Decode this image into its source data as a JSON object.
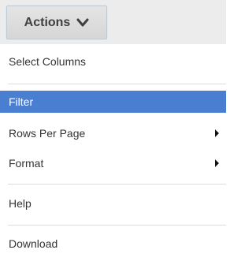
{
  "toolbar": {
    "actions_label": "Actions"
  },
  "menu": {
    "items": [
      {
        "label": "Select Columns"
      },
      {
        "label": "Filter",
        "highlighted": true
      },
      {
        "label": "Rows Per Page",
        "submenu": true
      },
      {
        "label": "Format",
        "submenu": true
      },
      {
        "label": "Help"
      },
      {
        "label": "Download"
      }
    ]
  },
  "colors": {
    "highlight": "#4a7ed0",
    "toolbar_bg": "#ececec"
  },
  "icons": {
    "actions_chevron": "chevron-down-icon",
    "submenu_arrow": "caret-right-icon"
  }
}
